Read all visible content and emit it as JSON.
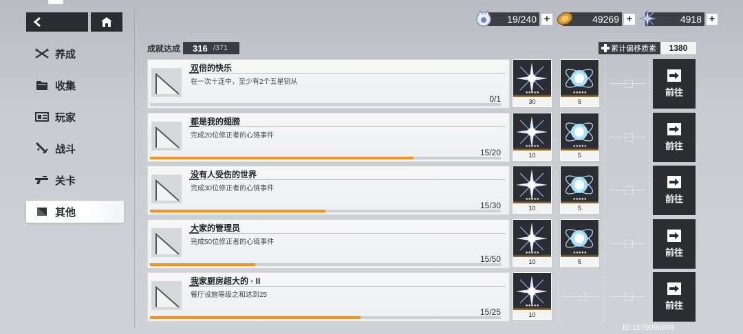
{
  "nav": {
    "back_icon": "chevron-left-icon",
    "home_icon": "home-icon"
  },
  "sidebar": {
    "items": [
      {
        "label": "养成",
        "icon": "crossed-blades-icon",
        "active": false
      },
      {
        "label": "收集",
        "icon": "folder-icon",
        "active": false
      },
      {
        "label": "玩家",
        "icon": "id-card-icon",
        "active": false
      },
      {
        "label": "战斗",
        "icon": "sword-icon",
        "active": false
      },
      {
        "label": "关卡",
        "icon": "gun-icon",
        "active": false
      },
      {
        "label": "其他",
        "icon": "triangle-flag-icon",
        "active": true
      }
    ]
  },
  "currencies": [
    {
      "name": "stamina",
      "icon": "cat-energy-icon",
      "value": "19/240"
    },
    {
      "name": "coin",
      "icon": "coin-icon",
      "value": "49269"
    },
    {
      "name": "crystal",
      "icon": "crystal-star-icon",
      "value": "4918"
    }
  ],
  "header": {
    "achievement_label": "成就达成",
    "achievement_done": "316",
    "achievement_total": "/371",
    "deviation_label": "累计偏移质素",
    "deviation_value": "1380"
  },
  "achievements": [
    {
      "title": "双倍的快乐",
      "desc": "在一次十连中，至少有2个五星钥从",
      "progress_text": "0/1",
      "progress": 0.0,
      "rewards": [
        {
          "type": "crystal-star",
          "qty": "30"
        },
        {
          "type": "orb",
          "qty": "5"
        }
      ],
      "button": "前往"
    },
    {
      "title": "都是我的翅膀",
      "desc": "完成20位修正者的心链事件",
      "progress_text": "15/20",
      "progress": 0.75,
      "rewards": [
        {
          "type": "crystal-star",
          "qty": "10"
        },
        {
          "type": "orb",
          "qty": "5"
        }
      ],
      "button": "前往"
    },
    {
      "title": "没有人受伤的世界",
      "desc": "完成30位修正者的心链事件",
      "progress_text": "15/30",
      "progress": 0.5,
      "rewards": [
        {
          "type": "crystal-star",
          "qty": "10"
        },
        {
          "type": "orb",
          "qty": "5"
        }
      ],
      "button": "前往"
    },
    {
      "title": "大家的管理员",
      "desc": "完成50位修正者的心链事件",
      "progress_text": "15/50",
      "progress": 0.3,
      "rewards": [
        {
          "type": "crystal-star",
          "qty": "10"
        },
        {
          "type": "orb",
          "qty": "5"
        }
      ],
      "button": "前往"
    },
    {
      "title": "我家厨房超大的 · II",
      "desc": "餐厅设施等级之和达到25",
      "progress_text": "15/25",
      "progress": 0.6,
      "rewards": [
        {
          "type": "crystal-star",
          "qty": "10"
        }
      ],
      "button": "前往"
    }
  ],
  "footer": {
    "player_id": "ID:1079095869"
  },
  "colors": {
    "accent": "#f0951e",
    "dark": "#2c2d31"
  }
}
